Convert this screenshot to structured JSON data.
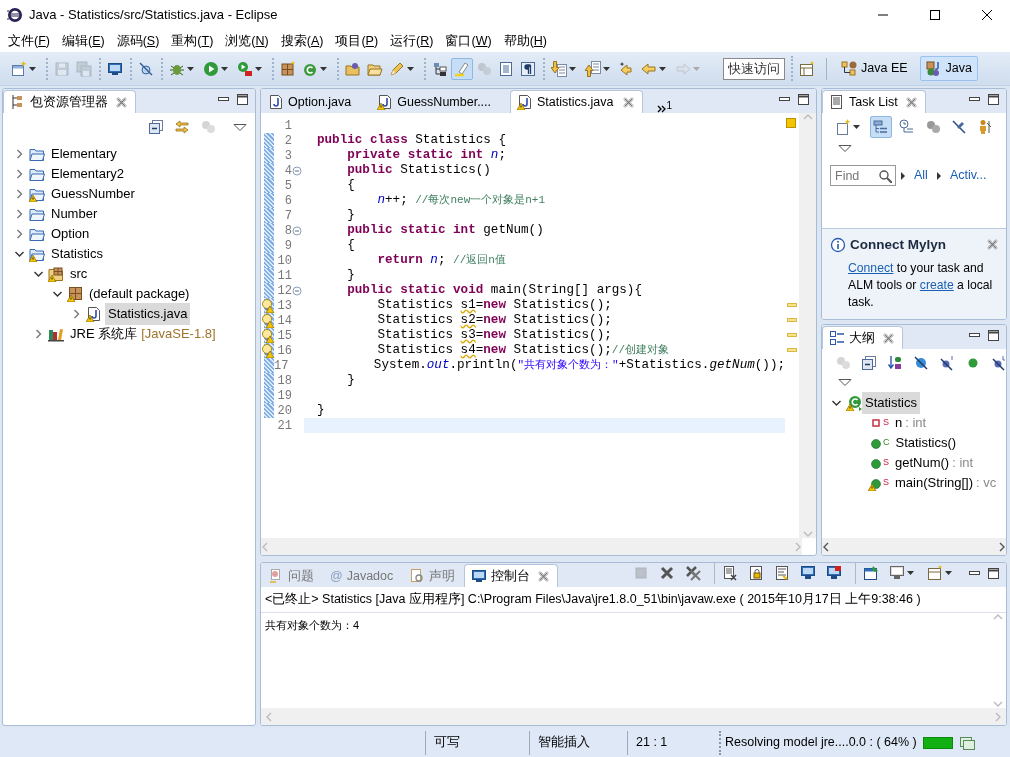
{
  "window": {
    "title": "Java  -  Statistics/src/Statistics.java  -  Eclipse"
  },
  "menu": [
    {
      "label": "文件(F)"
    },
    {
      "label": "编辑(E)"
    },
    {
      "label": "源码(S)"
    },
    {
      "label": "重构(T)"
    },
    {
      "label": "浏览(N)"
    },
    {
      "label": "搜索(A)"
    },
    {
      "label": "项目(P)"
    },
    {
      "label": "运行(R)"
    },
    {
      "label": "窗口(W)"
    },
    {
      "label": "帮助(H)"
    }
  ],
  "toolbar": {
    "groups": [
      [
        {
          "kind": "new-document",
          "dropdown": true,
          "disabled": false,
          "on": false
        }
      ],
      [
        {
          "kind": "save",
          "dropdown": false,
          "disabled": true,
          "on": false
        },
        {
          "kind": "save-all",
          "dropdown": false,
          "disabled": true,
          "on": false
        }
      ],
      [
        {
          "kind": "monitor",
          "dropdown": false,
          "disabled": false,
          "on": false
        }
      ],
      [
        {
          "kind": "skip-breakpoints",
          "dropdown": false,
          "disabled": false,
          "on": false
        }
      ],
      [
        {
          "kind": "debug",
          "dropdown": true,
          "disabled": false,
          "on": false
        },
        {
          "kind": "run",
          "dropdown": true,
          "disabled": false,
          "on": false
        },
        {
          "kind": "run-external",
          "dropdown": true,
          "disabled": false,
          "on": false
        }
      ],
      [
        {
          "kind": "new-package",
          "dropdown": false,
          "disabled": false,
          "on": false
        },
        {
          "kind": "new-class",
          "dropdown": true,
          "disabled": false,
          "on": false
        }
      ],
      [
        {
          "kind": "open-type",
          "dropdown": false,
          "disabled": false,
          "on": false
        },
        {
          "kind": "open-folder",
          "dropdown": false,
          "disabled": false,
          "on": false
        },
        {
          "kind": "pencil",
          "dropdown": true,
          "disabled": false,
          "on": false
        }
      ],
      [
        {
          "kind": "hierarchy",
          "dropdown": false,
          "disabled": false,
          "on": false
        },
        {
          "kind": "highlighter",
          "dropdown": false,
          "disabled": false,
          "on": true
        },
        {
          "kind": "gears",
          "dropdown": false,
          "disabled": true,
          "on": false
        },
        {
          "kind": "document",
          "dropdown": false,
          "disabled": false,
          "on": false
        },
        {
          "kind": "pilcrow",
          "dropdown": false,
          "disabled": false,
          "on": false
        }
      ],
      [
        {
          "kind": "down-annotation",
          "dropdown": true,
          "disabled": false,
          "on": false
        },
        {
          "kind": "up-annotation",
          "dropdown": true,
          "disabled": false,
          "on": false
        },
        {
          "kind": "last-edit",
          "dropdown": false,
          "disabled": false,
          "on": false
        },
        {
          "kind": "back",
          "dropdown": true,
          "disabled": false,
          "on": false
        },
        {
          "kind": "forward",
          "dropdown": true,
          "disabled": true,
          "on": false
        }
      ]
    ],
    "quick_access": {
      "placeholder": "快速访问"
    },
    "perspectives": [
      {
        "label": "Java EE",
        "kind": "javaee",
        "selected": false
      },
      {
        "label": "Java",
        "kind": "java",
        "selected": true
      }
    ]
  },
  "package_explorer": {
    "title": "包资源管理器",
    "toolbar": [
      {
        "kind": "collapse-all",
        "disabled": false
      },
      {
        "kind": "link",
        "disabled": false
      },
      {
        "kind": "gears",
        "disabled": true
      }
    ],
    "tree": [
      {
        "label": "Elementary",
        "kind": "project",
        "warning": false,
        "expanded": false,
        "selected": false
      },
      {
        "label": "Elementary2",
        "kind": "project",
        "warning": false,
        "expanded": false,
        "selected": false
      },
      {
        "label": "GuessNumber",
        "kind": "project",
        "warning": true,
        "expanded": false,
        "selected": false
      },
      {
        "label": "Number",
        "kind": "project",
        "warning": false,
        "expanded": false,
        "selected": false
      },
      {
        "label": "Option",
        "kind": "project",
        "warning": false,
        "expanded": false,
        "selected": false
      },
      {
        "label": "Statistics",
        "kind": "project",
        "warning": true,
        "expanded": true,
        "selected": false,
        "children": [
          {
            "label": "src",
            "kind": "source-folder",
            "warning": true,
            "expanded": true,
            "selected": false,
            "children": [
              {
                "label": "(default package)",
                "kind": "package",
                "warning": true,
                "expanded": true,
                "selected": false,
                "children": [
                  {
                    "label": "Statistics.java",
                    "kind": "java-file",
                    "warning": true,
                    "expanded": false,
                    "selected": true
                  }
                ]
              }
            ]
          },
          {
            "label": "JRE 系统库",
            "decoration": "[JavaSE-1.8]",
            "kind": "library",
            "warning": false,
            "expanded": false,
            "selected": false
          }
        ]
      }
    ]
  },
  "editor": {
    "tabs": [
      {
        "label": "Option.java",
        "warning": false,
        "selected": false
      },
      {
        "label": "GuessNumber....",
        "warning": true,
        "selected": false
      },
      {
        "label": "Statistics.java",
        "warning": true,
        "selected": true
      }
    ],
    "overflow_count": "1",
    "lines": [
      {
        "number": "1",
        "changed": false,
        "warning": false,
        "fold_toggle": false,
        "current": false
      },
      {
        "number": "2",
        "changed": true,
        "warning": false,
        "fold_toggle": false,
        "current": false,
        "tokens": [
          {
            "kind": "keyword",
            "text": "public class"
          },
          {
            "kind": "plain",
            "text": " Statistics {"
          }
        ]
      },
      {
        "number": "3",
        "changed": true,
        "warning": false,
        "fold_toggle": false,
        "current": false,
        "tokens": [
          {
            "kind": "keyword",
            "text": "    private static int"
          },
          {
            "kind": "field",
            "text": " n"
          },
          {
            "kind": "plain",
            "text": ";"
          }
        ]
      },
      {
        "number": "4",
        "changed": true,
        "warning": false,
        "fold_toggle": true,
        "current": false,
        "tokens": [
          {
            "kind": "keyword",
            "text": "    public"
          },
          {
            "kind": "plain",
            "text": " Statistics()"
          }
        ]
      },
      {
        "number": "5",
        "changed": true,
        "warning": false,
        "fold_toggle": false,
        "current": false,
        "tokens": [
          {
            "kind": "plain",
            "text": "    {"
          }
        ]
      },
      {
        "number": "6",
        "changed": true,
        "warning": false,
        "fold_toggle": false,
        "current": false,
        "tokens": [
          {
            "kind": "field",
            "text": "        n"
          },
          {
            "kind": "plain",
            "text": "++; "
          },
          {
            "kind": "comment",
            "text": "//每次new一个对象是n+1"
          }
        ]
      },
      {
        "number": "7",
        "changed": true,
        "warning": false,
        "fold_toggle": false,
        "current": false,
        "tokens": [
          {
            "kind": "plain",
            "text": "    }"
          }
        ]
      },
      {
        "number": "8",
        "changed": true,
        "warning": false,
        "fold_toggle": true,
        "current": false,
        "tokens": [
          {
            "kind": "keyword",
            "text": "    public static int"
          },
          {
            "kind": "plain",
            "text": " getNum()"
          }
        ]
      },
      {
        "number": "9",
        "changed": true,
        "warning": false,
        "fold_toggle": false,
        "current": false,
        "tokens": [
          {
            "kind": "plain",
            "text": "    {"
          }
        ]
      },
      {
        "number": "10",
        "changed": true,
        "warning": false,
        "fold_toggle": false,
        "current": false,
        "tokens": [
          {
            "kind": "keyword",
            "text": "        return"
          },
          {
            "kind": "field",
            "text": " n"
          },
          {
            "kind": "plain",
            "text": "; "
          },
          {
            "kind": "comment",
            "text": "//返回n值"
          }
        ]
      },
      {
        "number": "11",
        "changed": true,
        "warning": false,
        "fold_toggle": false,
        "current": false,
        "tokens": [
          {
            "kind": "plain",
            "text": "    }"
          }
        ]
      },
      {
        "number": "12",
        "changed": true,
        "warning": false,
        "fold_toggle": true,
        "current": false,
        "tokens": [
          {
            "kind": "keyword",
            "text": "    public static void"
          },
          {
            "kind": "plain",
            "text": " main(String[] args){"
          }
        ]
      },
      {
        "number": "13",
        "changed": true,
        "warning": true,
        "fold_toggle": false,
        "current": false,
        "tokens": [
          {
            "kind": "plain",
            "text": "        Statistics "
          },
          {
            "kind": "unused",
            "text": "s1"
          },
          {
            "kind": "plain",
            "text": "="
          },
          {
            "kind": "keyword",
            "text": "new"
          },
          {
            "kind": "plain",
            "text": " Statistics();"
          }
        ]
      },
      {
        "number": "14",
        "changed": true,
        "warning": true,
        "fold_toggle": false,
        "current": false,
        "tokens": [
          {
            "kind": "plain",
            "text": "        Statistics "
          },
          {
            "kind": "unused",
            "text": "s2"
          },
          {
            "kind": "plain",
            "text": "="
          },
          {
            "kind": "keyword",
            "text": "new"
          },
          {
            "kind": "plain",
            "text": " Statistics();"
          }
        ]
      },
      {
        "number": "15",
        "changed": true,
        "warning": true,
        "fold_toggle": false,
        "current": false,
        "tokens": [
          {
            "kind": "plain",
            "text": "        Statistics "
          },
          {
            "kind": "unused",
            "text": "s3"
          },
          {
            "kind": "plain",
            "text": "="
          },
          {
            "kind": "keyword",
            "text": "new"
          },
          {
            "kind": "plain",
            "text": " Statistics();"
          }
        ]
      },
      {
        "number": "16",
        "changed": true,
        "warning": true,
        "fold_toggle": false,
        "current": false,
        "tokens": [
          {
            "kind": "plain",
            "text": "        Statistics "
          },
          {
            "kind": "unused",
            "text": "s4"
          },
          {
            "kind": "plain",
            "text": "="
          },
          {
            "kind": "keyword",
            "text": "new"
          },
          {
            "kind": "plain",
            "text": " Statistics();"
          },
          {
            "kind": "comment",
            "text": "//创建对象"
          }
        ]
      },
      {
        "number": "17",
        "changed": true,
        "warning": false,
        "fold_toggle": false,
        "current": false,
        "tokens": [
          {
            "kind": "plain",
            "text": "        System."
          },
          {
            "kind": "field",
            "text": "out"
          },
          {
            "kind": "plain",
            "text": ".println("
          },
          {
            "kind": "string",
            "text": "\"共有对象个数为：\""
          },
          {
            "kind": "plain",
            "text": "+Statistics."
          },
          {
            "kind": "static-call",
            "text": "getNum"
          },
          {
            "kind": "plain",
            "text": "());"
          }
        ]
      },
      {
        "number": "18",
        "changed": true,
        "warning": false,
        "fold_toggle": false,
        "current": false,
        "tokens": [
          {
            "kind": "plain",
            "text": "    }"
          }
        ]
      },
      {
        "number": "19",
        "changed": true,
        "warning": false,
        "fold_toggle": false,
        "current": false
      },
      {
        "number": "20",
        "changed": true,
        "warning": false,
        "fold_toggle": false,
        "current": false,
        "tokens": [
          {
            "kind": "plain",
            "text": "}"
          }
        ]
      },
      {
        "number": "21",
        "changed": false,
        "warning": false,
        "fold_toggle": false,
        "current": true
      }
    ]
  },
  "task_list": {
    "title": "Task List",
    "toolbar": [
      {
        "kind": "new-task",
        "dropdown": true,
        "on": false
      },
      {
        "kind": "categorized",
        "dropdown": false,
        "on": true
      },
      {
        "kind": "scheduled",
        "dropdown": false,
        "on": false
      },
      {
        "kind": "gears",
        "dropdown": false,
        "on": false
      },
      {
        "kind": "focus",
        "dropdown": false,
        "on": false
      },
      {
        "kind": "person",
        "dropdown": false,
        "on": false
      }
    ],
    "find": {
      "placeholder": "Find"
    },
    "filters": [
      {
        "label": "All"
      },
      {
        "label": "Activ..."
      }
    ],
    "mylyn": {
      "title": "Connect Mylyn",
      "text": [
        {
          "text": "Connect",
          "link": true
        },
        {
          "text": " to your task and ALM tools or ",
          "link": false
        },
        {
          "text": "create",
          "link": true
        },
        {
          "text": " a local task.",
          "link": false
        }
      ]
    }
  },
  "outline": {
    "title": "大纲",
    "toolbar": [
      {
        "kind": "gears",
        "disabled": true
      },
      {
        "kind": "collapse-all",
        "disabled": false
      },
      {
        "kind": "sort",
        "disabled": false
      },
      {
        "kind": "hide-fields",
        "disabled": false
      },
      {
        "kind": "hide-static",
        "disabled": false
      },
      {
        "kind": "hide-nonpublic",
        "disabled": false
      },
      {
        "kind": "hide-local",
        "disabled": false
      }
    ],
    "tree": [
      {
        "label": "Statistics",
        "kind": "class",
        "warning": true,
        "expanded": true,
        "selected": true,
        "children": [
          {
            "label": "n",
            "type": ": int",
            "modifier": "S",
            "kind": "private-field",
            "warning": false,
            "selected": false
          },
          {
            "label": "Statistics()",
            "modifier": "C",
            "kind": "constructor",
            "warning": false,
            "selected": false
          },
          {
            "label": "getNum()",
            "type": ": int",
            "modifier": "S",
            "kind": "public-method",
            "warning": false,
            "selected": false
          },
          {
            "label": "main(String[])",
            "type": ": vc",
            "modifier": "S",
            "kind": "public-method",
            "warning": true,
            "selected": false
          }
        ]
      }
    ]
  },
  "console": {
    "tabs": [
      {
        "label": "问题",
        "kind": "problems",
        "selected": false
      },
      {
        "label": "Javadoc",
        "kind": "javadoc",
        "glyph": "@",
        "selected": false
      },
      {
        "label": "声明",
        "kind": "declaration",
        "selected": false
      },
      {
        "label": "控制台",
        "kind": "console",
        "selected": true
      }
    ],
    "toolbar": [
      [
        {
          "kind": "terminate",
          "dropdown": false,
          "disabled": true
        },
        {
          "kind": "remove",
          "dropdown": false,
          "disabled": false
        },
        {
          "kind": "remove-all",
          "dropdown": false,
          "disabled": false
        }
      ],
      [
        {
          "kind": "clear",
          "dropdown": false,
          "disabled": false
        },
        {
          "kind": "scroll-lock",
          "dropdown": false,
          "disabled": false
        },
        {
          "kind": "word-wrap",
          "dropdown": false,
          "disabled": false
        },
        {
          "kind": "show-output",
          "dropdown": false,
          "disabled": false
        },
        {
          "kind": "show-error",
          "dropdown": false,
          "disabled": false
        }
      ],
      [
        {
          "kind": "pin",
          "dropdown": false,
          "disabled": false
        },
        {
          "kind": "display",
          "dropdown": true,
          "disabled": false
        },
        {
          "kind": "open-console",
          "dropdown": true,
          "disabled": false
        }
      ]
    ],
    "header": "<已终止> Statistics [Java 应用程序] C:\\Program Files\\Java\\jre1.8.0_51\\bin\\javaw.exe ( 2015年10月17日 上午9:38:46 )",
    "output": "共有对象个数为：4"
  },
  "status_bar": {
    "fields": [
      "可写",
      "智能插入",
      "21 : 1"
    ],
    "job": "Resolving model jre....0.0 : ( 64% )"
  }
}
